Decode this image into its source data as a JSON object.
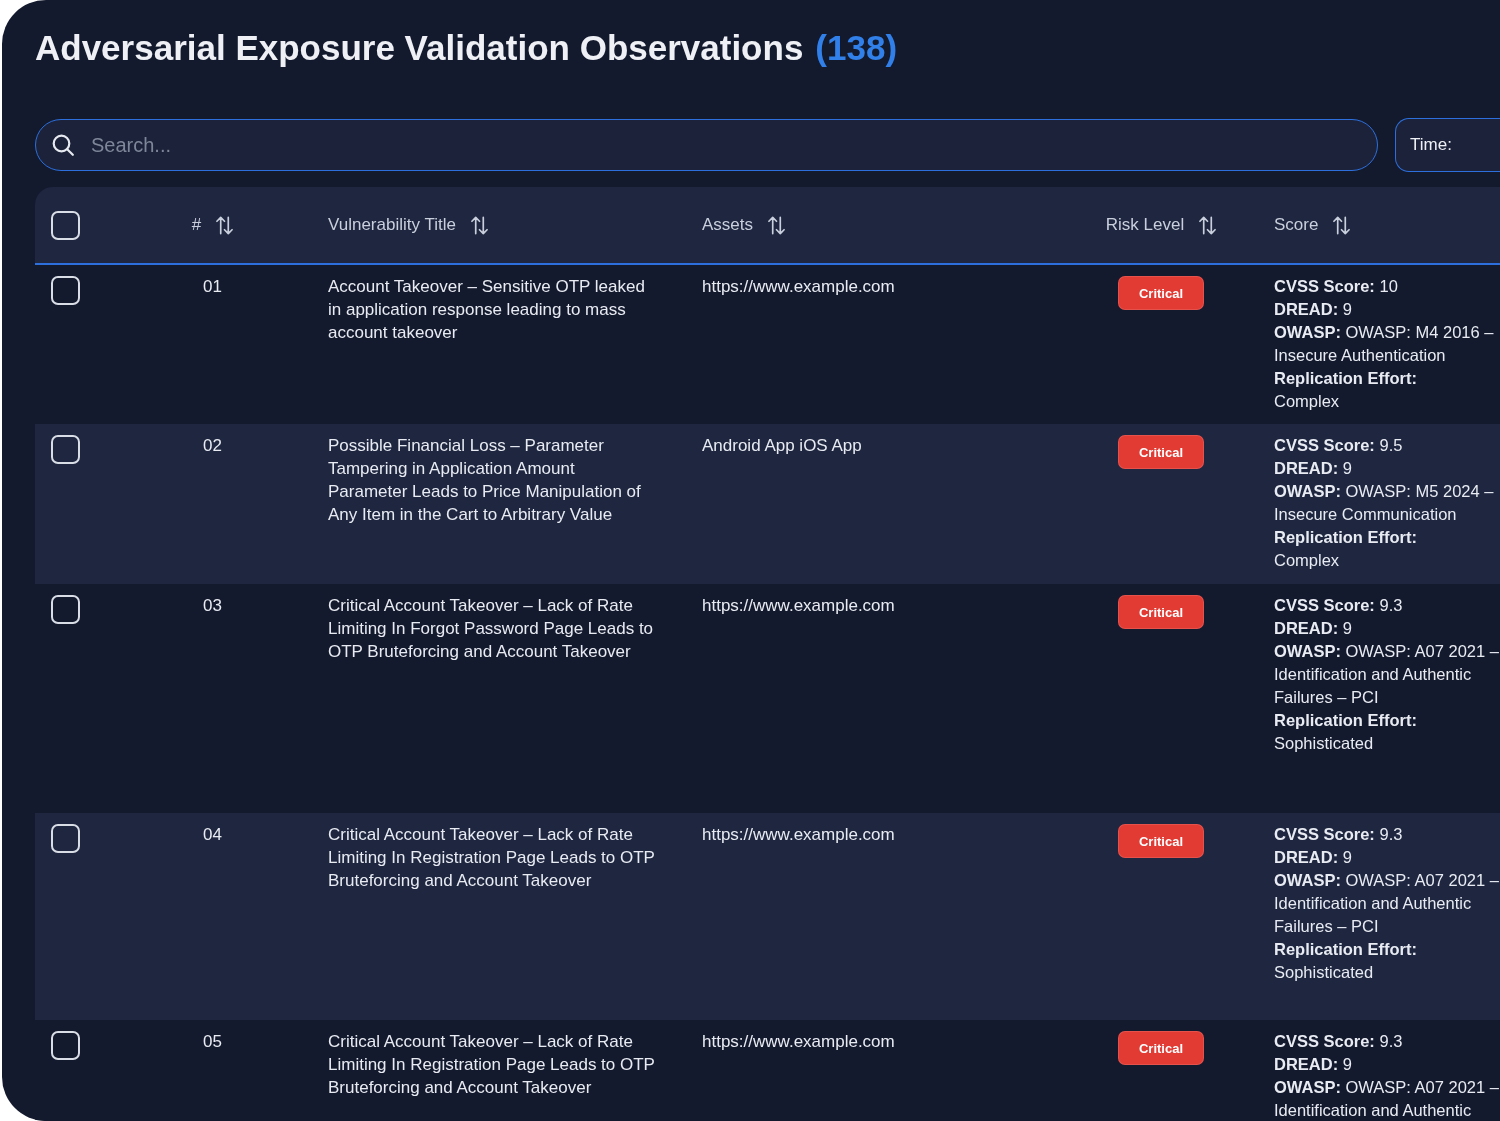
{
  "title": {
    "text": "Adversarial Exposure Validation Observations",
    "count": "(138)"
  },
  "search": {
    "placeholder": "Search..."
  },
  "time_filter": {
    "label": "Time:"
  },
  "table": {
    "select_all": {
      "checked": false
    },
    "columns": [
      {
        "label": "#"
      },
      {
        "label": "Vulnerability Title"
      },
      {
        "label": "Assets"
      },
      {
        "label": "Risk Level"
      },
      {
        "label": "Score"
      }
    ],
    "rows": [
      {
        "checked": false,
        "number": "01",
        "title": "Account Takeover – Sensitive OTP leaked in application response leading to mass account takeover",
        "assets": "https://www.example.com",
        "risk": {
          "label": "Critical",
          "color": "#e23b33"
        },
        "score": [
          "**CVSS Score:** 10",
          "**DREAD:** 9",
          "**OWASP:** OWASP: M4 2016 –",
          "Insecure Authentication",
          "**Replication Effort:**",
          "Complex"
        ]
      },
      {
        "checked": false,
        "number": "02",
        "title": "Possible Financial Loss – Parameter Tampering in Application Amount Parameter Leads to Price Manipulation of Any Item in the Cart to Arbitrary Value",
        "assets": "Android App iOS App",
        "risk": {
          "label": "Critical",
          "color": "#e23b33"
        },
        "score": [
          "**CVSS Score:** 9.5",
          "**DREAD:** 9",
          "**OWASP:** OWASP: M5 2024 –",
          "Insecure Communication",
          "**Replication Effort:**",
          "Complex"
        ]
      },
      {
        "checked": false,
        "number": "03",
        "title": "Critical Account Takeover – Lack of Rate Limiting In Forgot Password Page Leads to OTP Bruteforcing and Account Takeover",
        "assets": "https://www.example.com",
        "risk": {
          "label": "Critical",
          "color": "#e23b33"
        },
        "score": [
          "**CVSS Score:** 9.3",
          "**DREAD:** 9",
          "**OWASP:** OWASP: A07 2021 –",
          "Identification and Authentic",
          "Failures – PCI",
          "**Replication Effort:**",
          "Sophisticated"
        ]
      },
      {
        "checked": false,
        "number": "04",
        "title": "Critical Account Takeover – Lack of Rate Limiting In Registration Page Leads to OTP Bruteforcing and Account Takeover",
        "assets": "https://www.example.com",
        "risk": {
          "label": "Critical",
          "color": "#e23b33"
        },
        "score": [
          "**CVSS Score:** 9.3",
          "**DREAD:** 9",
          "**OWASP:** OWASP: A07 2021 –",
          "Identification and Authentic",
          "Failures – PCI",
          "**Replication Effort:**",
          "Sophisticated"
        ]
      },
      {
        "checked": false,
        "number": "05",
        "title": "Critical Account Takeover – Lack of Rate Limiting In Registration Page Leads to OTP Bruteforcing and Account Takeover",
        "assets": "https://www.example.com",
        "risk": {
          "label": "Critical",
          "color": "#e23b33"
        },
        "score": [
          "**CVSS Score:** 9.3",
          "**DREAD:** 9",
          "**OWASP:** OWASP: A07 2021 –",
          "Identification and Authentic"
        ]
      }
    ]
  }
}
